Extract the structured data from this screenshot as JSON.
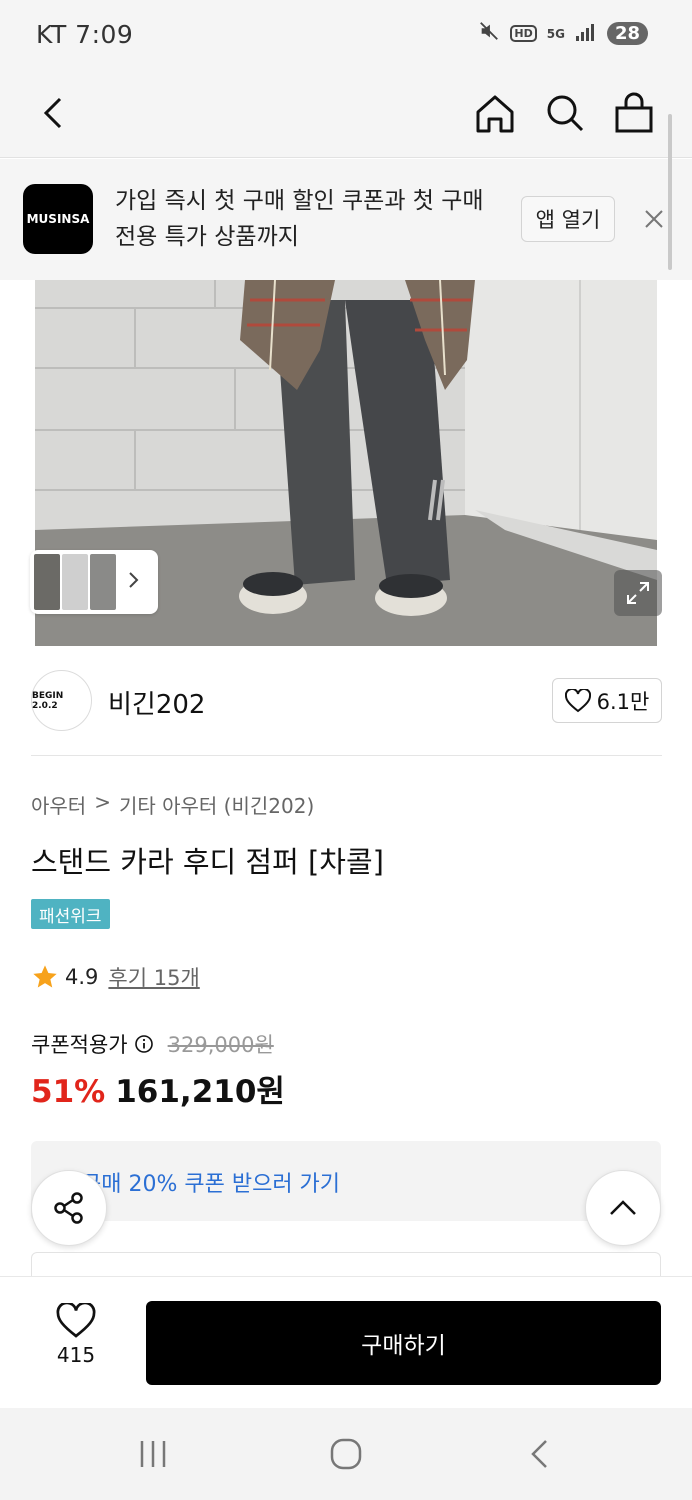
{
  "status_bar": {
    "carrier_time": "KT 7:09",
    "hd": "HD",
    "network": "5G",
    "battery": "28"
  },
  "app_banner": {
    "logo_text": "MUSINSA",
    "message_line1": "가입 즉시 첫 구매 할인 쿠폰과 첫 구매",
    "message_line2": "전용 특가 상품까지",
    "open_app_label": "앱 열기"
  },
  "brand": {
    "logo_text": "BEGIN 2.0.2",
    "name": "비긴202",
    "likes": "6.1만"
  },
  "product": {
    "breadcrumb_category": "아우터",
    "breadcrumb_sep": ">",
    "breadcrumb_sub": "기타 아우터 (비긴202)",
    "title": "스탠드 카라 후디 점퍼 [차콜]",
    "tag": "패션위크",
    "rating": "4.9",
    "reviews": "후기 15개",
    "coupon_price_label": "쿠폰적용가",
    "original_price": "329,000원",
    "discount": "51%",
    "price": "161,210원"
  },
  "coupon_banner": {
    "text": "구매 20% 쿠폰 받으러 가기"
  },
  "buy_bar": {
    "like_count": "415",
    "buy_label": "구매하기"
  },
  "colors": {
    "discount": "#e1251b",
    "coupon_link": "#2b6fd4",
    "tag_bg": "#4fb3c2",
    "star": "#f7a21b"
  }
}
